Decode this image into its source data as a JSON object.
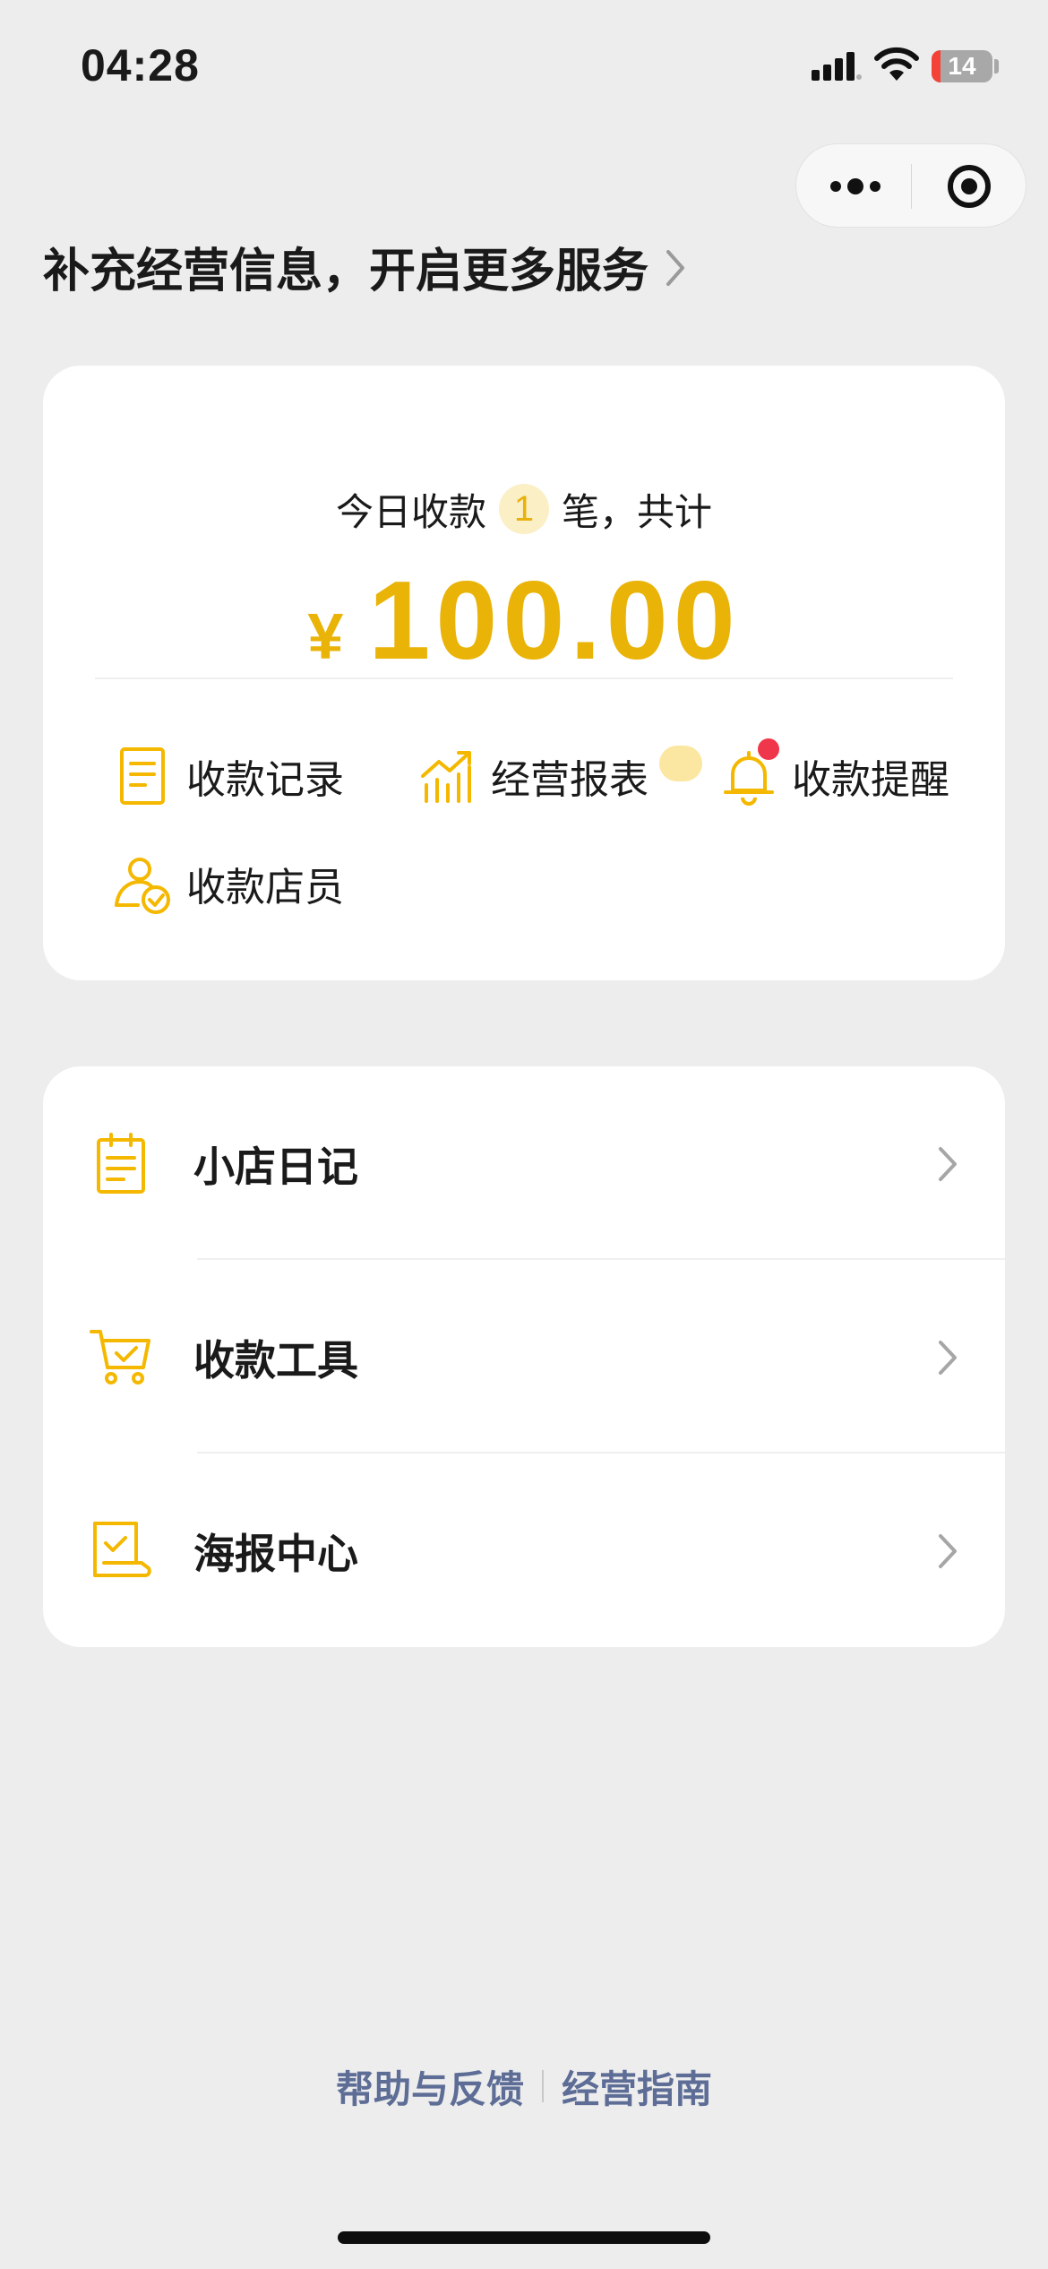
{
  "status_bar": {
    "time": "04:28",
    "battery": "14",
    "battery_level": 0.14,
    "signal_icon": "cellular-signal-icon",
    "wifi_icon": "wifi-icon"
  },
  "capsule": {
    "more_icon": "more-dots-icon",
    "close_icon": "target-close-icon"
  },
  "banner": {
    "text": "补充经营信息，开启更多服务"
  },
  "summary": {
    "prefix": "今日收款",
    "count": "1",
    "suffix": "笔，共计",
    "currency": "¥",
    "amount": "100.00"
  },
  "actions": [
    {
      "label": "收款记录",
      "icon": "document-icon"
    },
    {
      "label": "经营报表",
      "icon": "chart-trend-icon"
    },
    {
      "label": "收款提醒",
      "icon": "bell-icon"
    },
    {
      "label": "收款店员",
      "icon": "staff-check-icon"
    }
  ],
  "menu": [
    {
      "label": "小店日记",
      "icon": "notebook-icon"
    },
    {
      "label": "收款工具",
      "icon": "cart-check-icon"
    },
    {
      "label": "海报中心",
      "icon": "poster-check-icon"
    }
  ],
  "footer": {
    "help": "帮助与反馈",
    "guide": "经营指南"
  },
  "colors": {
    "accent": "#EAB308",
    "background": "#EDEDED",
    "link": "#5D6D96",
    "badge_red": "#F0364A"
  }
}
